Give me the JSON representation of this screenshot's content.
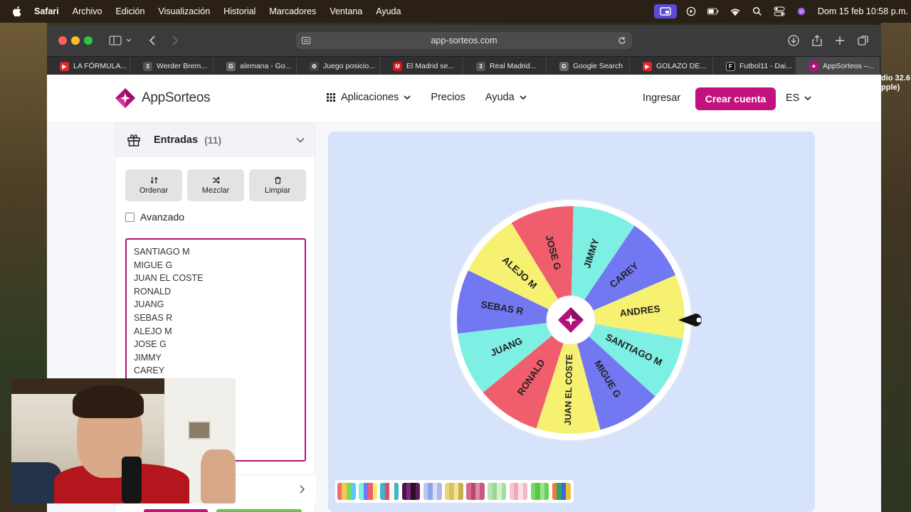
{
  "menubar": {
    "app": "Safari",
    "items": [
      "Archivo",
      "Edición",
      "Visualización",
      "Historial",
      "Marcadores",
      "Ventana",
      "Ayuda"
    ],
    "clock": "Dom 15 feb 10:58 p.m."
  },
  "desktop": {
    "right_text_1": "dio 32.6",
    "right_text_2": "pple)"
  },
  "browser": {
    "url": "app-sorteos.com",
    "tabs": [
      {
        "label": "LA FÓRMULA...",
        "color": "#e0242b",
        "glyph": "▶"
      },
      {
        "label": "Werder Brem...",
        "color": "#555555",
        "glyph": "3"
      },
      {
        "label": "alemana - Go...",
        "color": "#666666",
        "glyph": "G"
      },
      {
        "label": "Juego posicio...",
        "color": "#444444",
        "glyph": "⚙"
      },
      {
        "label": "El Madrid se...",
        "color": "#d2151c",
        "glyph": "M"
      },
      {
        "label": "Real Madrid...",
        "color": "#555555",
        "glyph": "3"
      },
      {
        "label": "Google Search",
        "color": "#666666",
        "glyph": "G"
      },
      {
        "label": "GOLAZO DE...",
        "color": "#e0242b",
        "glyph": "▶"
      },
      {
        "label": "Futbol11 - Dai...",
        "color": "#111111",
        "glyph": "F"
      },
      {
        "label": "AppSorteos –...",
        "color": "#b4107a",
        "glyph": "✦"
      }
    ]
  },
  "site": {
    "logo_text": "AppSorteos",
    "nav": {
      "apps": "Aplicaciones",
      "prices": "Precios",
      "help": "Ayuda"
    },
    "login": "Ingresar",
    "signup": "Crear cuenta",
    "lang": "ES",
    "brand_color": "#c2127e"
  },
  "panel": {
    "title": "Entradas",
    "count": "(11)",
    "actions": {
      "sort": "Ordenar",
      "shuffle": "Mezclar",
      "clear": "Limpiar"
    },
    "advanced": "Avanzado",
    "entries": [
      "SANTIAGO M",
      "MIGUE G",
      "JUAN EL COSTE",
      "RONALD",
      "JUANG",
      "SEBAS R",
      "ALEJO M",
      "JOSE G",
      "JIMMY",
      "CAREY"
    ]
  },
  "wheel": {
    "segments": [
      {
        "label": "ANDRES",
        "color": "#f6f171"
      },
      {
        "label": "SANTIAGO M",
        "color": "#7ef0e3"
      },
      {
        "label": "MIGUE G",
        "color": "#7277f2"
      },
      {
        "label": "JUAN EL COSTE",
        "color": "#f6f171"
      },
      {
        "label": "RONALD",
        "color": "#f05d6c"
      },
      {
        "label": "JUANG",
        "color": "#7ef0e3"
      },
      {
        "label": "SEBAS R",
        "color": "#7277f2"
      },
      {
        "label": "ALEJO M",
        "color": "#f6f171"
      },
      {
        "label": "JOSE G",
        "color": "#f05d6c"
      },
      {
        "label": "JIMMY",
        "color": "#7ef0e3"
      },
      {
        "label": "CAREY",
        "color": "#7277f2"
      }
    ]
  },
  "palette": [
    [
      "#f26d6d",
      "#f6c84c",
      "#7ed957",
      "#5bc8f5"
    ],
    [
      "#7ef0e3",
      "#7277f2",
      "#f05d6c",
      "#f6f171"
    ],
    [
      "#3db6c6",
      "#e84b6a",
      "#f7f7f7",
      "#3db6c6"
    ],
    [
      "#4a1448",
      "#7a2a78",
      "#2a0e28",
      "#5e1c5c"
    ],
    [
      "#b7c7f2",
      "#8fa3e8",
      "#d7dff7",
      "#aab8ee"
    ],
    [
      "#e8d77a",
      "#d9c15a",
      "#f2e49a",
      "#c9b04a"
    ],
    [
      "#d46a8e",
      "#b44a6e",
      "#e08aa6",
      "#c75a7e"
    ],
    [
      "#b9e6b0",
      "#9dd693",
      "#d3f1cc",
      "#a6dc9c"
    ],
    [
      "#f7c6d3",
      "#f2a8bb",
      "#fbe1e8",
      "#f6b8c8"
    ],
    [
      "#7ad86a",
      "#5cc54c",
      "#98e88a",
      "#6ccf5c"
    ],
    [
      "#f27a3a",
      "#2aa86a",
      "#3a6ad8",
      "#e8c23a"
    ]
  ]
}
